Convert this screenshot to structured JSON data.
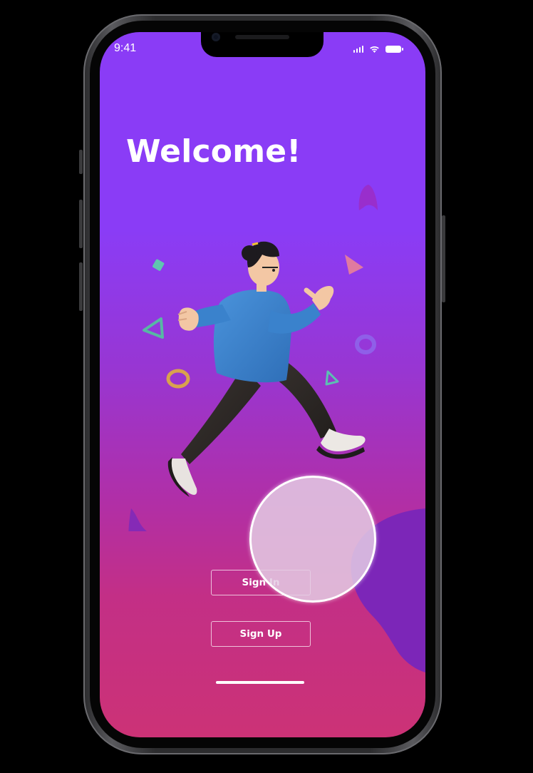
{
  "status_bar": {
    "time": "9:41",
    "icons": [
      "cellular-signal-icon",
      "wifi-icon",
      "battery-icon"
    ]
  },
  "welcome": {
    "title": "Welcome!"
  },
  "illustration": {
    "subject": "running-person-illustration"
  },
  "actions": {
    "sign_in_label": "Sign In",
    "sign_up_label": "Sign Up"
  },
  "colors": {
    "gradient_top": "#8a3cf6",
    "gradient_bottom": "#cc3276",
    "blob": "#7c26b8",
    "shirt": "#3f86d0"
  }
}
